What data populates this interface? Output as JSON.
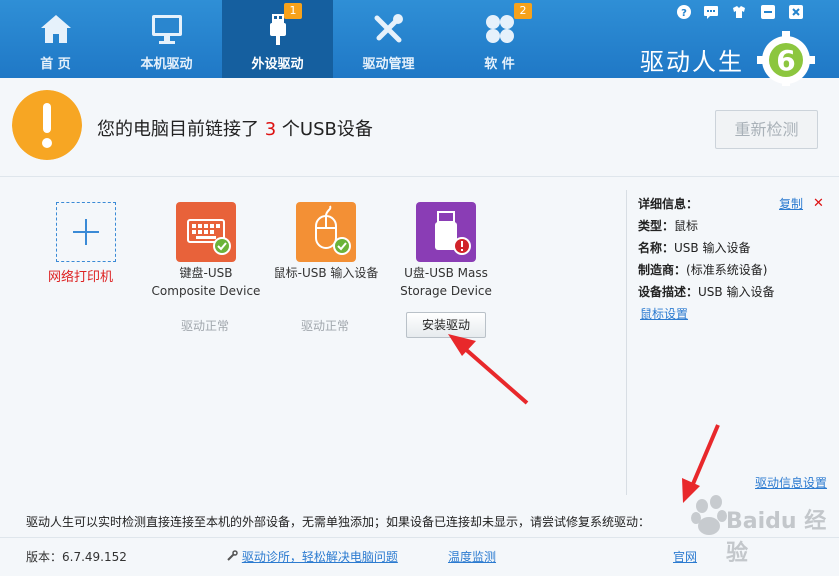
{
  "nav": [
    {
      "label": "首 页",
      "icon": "home-icon"
    },
    {
      "label": "本机驱动",
      "icon": "monitor-icon"
    },
    {
      "label": "外设驱动",
      "icon": "usb-icon",
      "badge": "1",
      "active": true
    },
    {
      "label": "驱动管理",
      "icon": "tools-icon"
    },
    {
      "label": "软 件",
      "icon": "apps-icon",
      "badge": "2"
    }
  ],
  "brand": {
    "name": "驱动人生",
    "logo": "6"
  },
  "window_buttons": [
    "help-icon",
    "message-icon",
    "skin-icon",
    "minimize-icon",
    "close-icon"
  ],
  "notice": {
    "prefix": "您的电脑目前链接了",
    "count": "3",
    "suffix": "个USB设备",
    "rescan": "重新检测"
  },
  "devices": {
    "add_label": "网络打印机",
    "items": [
      {
        "name_line1": "键盘-USB",
        "name_line2": "Composite Device",
        "status": "驱动正常",
        "color": "#e8623a",
        "icon": "keyboard-icon",
        "state": "ok"
      },
      {
        "name_line1": "鼠标-USB 输入设备",
        "name_line2": "",
        "status": "驱动正常",
        "color": "#f39035",
        "icon": "mouse-icon",
        "state": "ok"
      },
      {
        "name_line1": "U盘-USB Mass",
        "name_line2": "Storage Device",
        "status": "",
        "color": "#8a3db5",
        "icon": "usb-drive-icon",
        "state": "error"
      }
    ],
    "install_button": "安装驱动"
  },
  "detail": {
    "title": "详细信息：",
    "copy": "复制",
    "type_label": "类型：",
    "type_value": "鼠标",
    "name_label": "名称：",
    "name_value": "USB 输入设备",
    "maker_label": "制造商：",
    "maker_value": "(标准系统设备)",
    "desc_label": "设备描述：",
    "desc_value": "USB 输入设备",
    "mouse_settings": "鼠标设置",
    "driver_info_settings": "驱动信息设置"
  },
  "footer": {
    "message": "驱动人生可以实时检测直接连接至本机的外部设备，无需单独添加；如果设备已连接却未显示，请尝试修复系统驱动：",
    "version": "版本：6.7.49.152",
    "diagnosis": "驱动诊所，轻松解决电脑问题",
    "temperature": "温度监测",
    "site": "官网"
  },
  "watermark": "Baidu 经验",
  "colors": {
    "topbar": "#2483cc",
    "active_tab": "#155f9f",
    "accent": "#2c7bd0",
    "warn": "#f7a623",
    "badge": "#f7a21b",
    "error": "#d11"
  }
}
